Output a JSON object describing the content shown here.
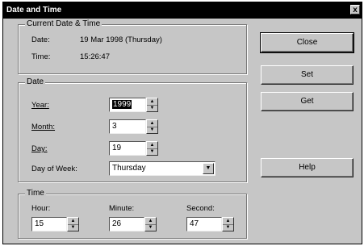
{
  "window": {
    "title": "Date and Time",
    "close_glyph": "x"
  },
  "current": {
    "legend": "Current Date & Time",
    "date_label": "Date:",
    "date_value": "19 Mar 1998 (Thursday)",
    "time_label": "Time:",
    "time_value": "15:26:47"
  },
  "date": {
    "legend": "Date",
    "year_label": "Year:",
    "year_value": "1999",
    "month_label": "Month:",
    "month_value": "3",
    "day_label": "Day:",
    "day_value": "19",
    "dow_label": "Day of Week:",
    "dow_value": "Thursday"
  },
  "time": {
    "legend": "Time",
    "hour_label": "Hour:",
    "hour_value": "15",
    "minute_label": "Minute:",
    "minute_value": "26",
    "second_label": "Second:",
    "second_value": "47"
  },
  "buttons": {
    "close": "Close",
    "set": "Set",
    "get": "Get",
    "help": "Help"
  },
  "icons": {
    "spin_up": "▲",
    "spin_down": "▼",
    "dropdown": "▼"
  }
}
